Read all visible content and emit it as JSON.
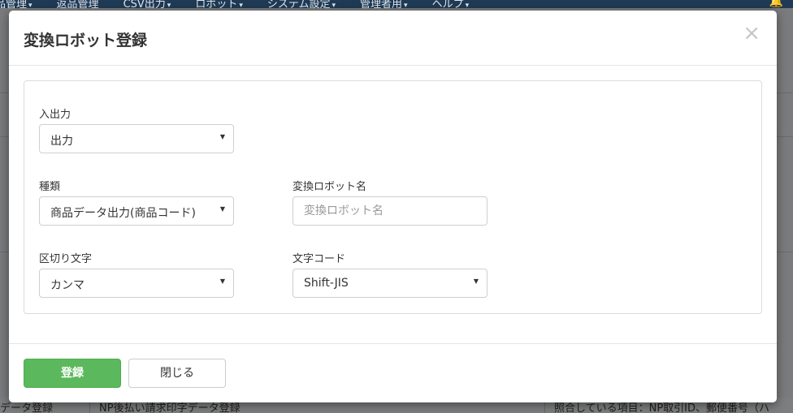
{
  "background": {
    "nav_items": [
      "品管理",
      "返品管理",
      "CSV出力",
      "ロボット",
      "システム設定",
      "管理者用",
      "ヘルプ"
    ],
    "nav_caret_items": [
      0,
      2,
      3,
      4,
      5,
      6
    ],
    "bottom_row": {
      "col1": "データ登録",
      "col2": "NP後払い請求印字データ登録",
      "col3": "照合している項目：NP取引ID、郵便番号（ハ"
    }
  },
  "modal": {
    "title": "変換ロボット登録",
    "close_symbol": "×",
    "fields": {
      "io": {
        "label": "入出力",
        "value": "出力"
      },
      "kind": {
        "label": "種類",
        "value": "商品データ出力(商品コード)"
      },
      "robot_name": {
        "label": "変換ロボット名",
        "value": "",
        "placeholder": "変換ロボット名"
      },
      "delimiter": {
        "label": "区切り文字",
        "value": "カンマ"
      },
      "encoding": {
        "label": "文字コード",
        "value": "Shift-JIS"
      }
    },
    "footer": {
      "submit_label": "登録",
      "close_label": "閉じる"
    },
    "colors": {
      "primary": "#5cb85c",
      "nav_bg": "#1f3a55"
    }
  }
}
